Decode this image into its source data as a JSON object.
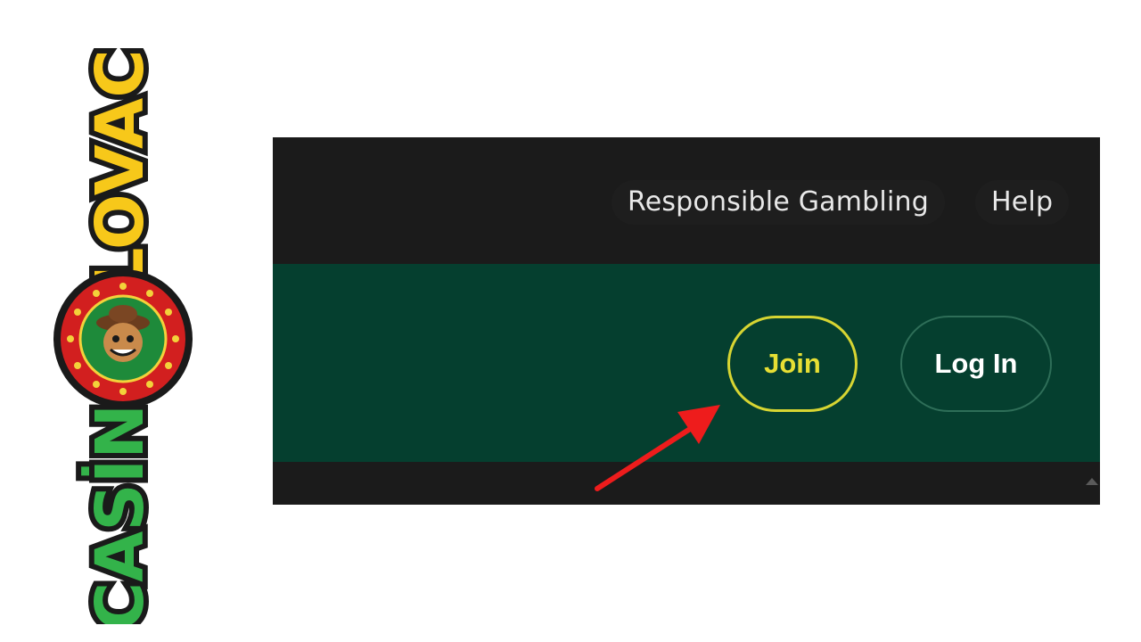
{
  "brand": {
    "logo_text_top": "LOVAC",
    "logo_text_bottom": "CASİN",
    "logo_icon": "cowboy-mascot-badge"
  },
  "header": {
    "links": [
      {
        "label": "Responsible Gambling"
      },
      {
        "label": "Help"
      }
    ]
  },
  "auth": {
    "join_label": "Join",
    "login_label": "Log In"
  },
  "annotation": {
    "arrow_icon": "red-pointer-arrow",
    "arrow_color": "#ee1c1c"
  },
  "colors": {
    "topbar": "#1b1b1b",
    "greenbar": "#053f2f",
    "join_accent": "#d7d532",
    "login_border": "#2e6e58"
  }
}
